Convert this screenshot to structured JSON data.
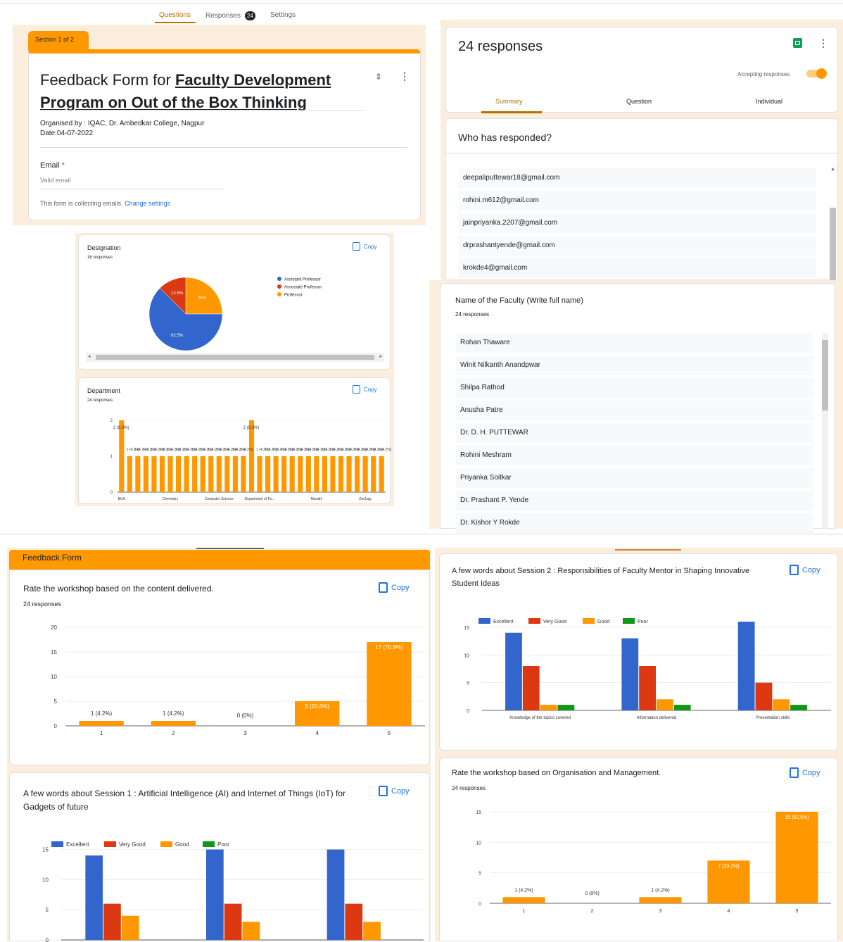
{
  "top_tabs": {
    "questions": "Questions",
    "responses": "Responses",
    "responses_count": "24",
    "settings": "Settings"
  },
  "form": {
    "section_label": "Section 1 of 2",
    "title_prefix": "Feedback Form for ",
    "title_line1_bold": "Faculty Development",
    "title_line2_bold": "Program on Out of the Box Thinking",
    "organised_by": "Organised by : IQAC, Dr. Ambedkar College, Nagpur",
    "date": "Date:04-07-2022",
    "email_label": "Email",
    "required_mark": "*",
    "email_placeholder": "Valid email",
    "collecting_note": "This form is collecting emails.",
    "change_settings": "Change settings"
  },
  "responses_panel": {
    "heading": "24 responses",
    "accepting_label": "Accepting responses",
    "tabs": [
      "Summary",
      "Question",
      "Individual"
    ],
    "who_title": "Who has responded?",
    "emails": [
      "deepaliputtewar18@gmail.com",
      "rohini.m612@gmail.com",
      "jainpriyanka.2207@gmail.com",
      "drprashantyende@gmail.com",
      "krokde4@gmail.com"
    ]
  },
  "faculty_panel": {
    "title": "Name of the Faculty (Write full name)",
    "count": "24 responses",
    "names": [
      "Rohan Thaware",
      "Winit Nilkanth Anandpwar",
      "Shilpa Rathod",
      "Anusha Patre",
      "Dr. D. H. PUTTEWAR",
      "Rohini Meshram",
      "Priyanka Soitkar",
      "Dr. Prashant P. Yende",
      "Dr. Kishor Y Rokde"
    ]
  },
  "copy_label": "Copy",
  "feedback_header": "Feedback Form",
  "colors": {
    "orange": "#ff9800",
    "blue": "#3366cc",
    "red": "#dc3912",
    "green": "#109618",
    "cream": "#fbeedd",
    "link": "#1a73e8",
    "header_orange": "#ff9900"
  },
  "chart_data": [
    {
      "type": "pie",
      "title": "Designation",
      "subtitle": "16 responses",
      "labels": [
        "Assistant Professor",
        "Associate Professor",
        "Professor"
      ],
      "values": [
        62.5,
        12.5,
        25
      ],
      "slice_labels": [
        "62.5%",
        "12.5%",
        "25%"
      ],
      "legend": "right"
    },
    {
      "type": "bar",
      "title": "Department",
      "subtitle": "24 responses",
      "tick_labels": [
        "BCA",
        "Chemistry",
        "Computer Science",
        "Department of Ps...",
        "Marathi",
        "Zoology"
      ],
      "values": [
        2,
        1,
        1,
        1,
        1,
        1,
        1,
        1,
        1,
        1,
        1,
        1,
        1,
        1,
        1,
        1,
        2,
        1,
        1,
        1,
        1,
        1,
        1,
        1,
        1,
        1,
        1,
        1,
        1,
        1,
        1,
        1,
        1
      ],
      "data_label_2": "2 (8.3%)",
      "data_label_1": "1 (4.2%)",
      "yticks": [
        0,
        1,
        2
      ],
      "ylim": [
        0,
        2
      ]
    },
    {
      "type": "bar",
      "title": "Rate the workshop based on the content delivered.",
      "subtitle": "24 responses",
      "categories": [
        "1",
        "2",
        "3",
        "4",
        "5"
      ],
      "values": [
        1,
        1,
        0,
        5,
        17
      ],
      "data_labels": [
        "1 (4.2%)",
        "1 (4.2%)",
        "0 (0%)",
        "5 (20.8%)",
        "17 (70.8%)"
      ],
      "yticks": [
        0,
        5,
        10,
        15,
        20
      ],
      "ylim": [
        0,
        20
      ]
    },
    {
      "type": "bar",
      "title": "A few words about Session 2 :  Responsibilities of Faculty Mentor in Shaping Innovative Student Ideas",
      "categories": [
        "Knowledge of the topics covered",
        "Information delivered",
        "Presentation skills"
      ],
      "series": [
        {
          "name": "Excellent",
          "values": [
            14,
            13,
            16
          ]
        },
        {
          "name": "Very Good",
          "values": [
            8,
            8,
            5
          ]
        },
        {
          "name": "Good",
          "values": [
            1,
            2,
            2
          ]
        },
        {
          "name": "Poor",
          "values": [
            1,
            1,
            1
          ]
        }
      ],
      "yticks": [
        0,
        5,
        10,
        15
      ],
      "ylim": [
        0,
        16
      ],
      "legend": "top"
    },
    {
      "type": "bar",
      "title": "A few words about Session 1 :  Artificial Intelligence (AI) and Internet of Things (IoT) for Gadgets of future",
      "categories": [
        "",
        "",
        ""
      ],
      "series": [
        {
          "name": "Excellent",
          "values": [
            14,
            15,
            15
          ]
        },
        {
          "name": "Very Good",
          "values": [
            6,
            6,
            6
          ]
        },
        {
          "name": "Good",
          "values": [
            4,
            3,
            3
          ]
        },
        {
          "name": "Poor",
          "values": [
            0,
            0,
            0
          ]
        }
      ],
      "yticks": [
        0,
        5,
        10,
        15
      ],
      "ylim": [
        0,
        16
      ],
      "legend": "top"
    },
    {
      "type": "bar",
      "title": "Rate the workshop  based on Organisation and Management.",
      "subtitle": "24 responses",
      "categories": [
        "1",
        "2",
        "3",
        "4",
        "5"
      ],
      "values": [
        1,
        0,
        1,
        7,
        15
      ],
      "data_labels": [
        "1 (4.2%)",
        "0 (0%)",
        "1 (4.2%)",
        "7 (29.2%)",
        "15 (62.5%)"
      ],
      "yticks": [
        0,
        5,
        10,
        15
      ],
      "ylim": [
        0,
        15
      ]
    }
  ]
}
